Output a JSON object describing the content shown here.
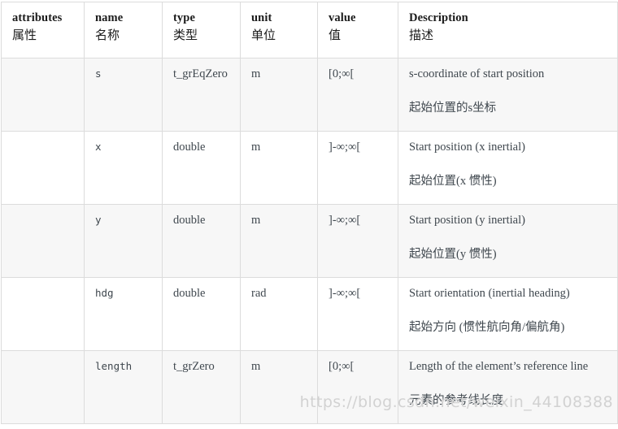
{
  "table": {
    "columns": [
      {
        "key": "attributes",
        "label_en": "attributes",
        "label_zh": "属性"
      },
      {
        "key": "name",
        "label_en": "name",
        "label_zh": "名称"
      },
      {
        "key": "type",
        "label_en": "type",
        "label_zh": "类型"
      },
      {
        "key": "unit",
        "label_en": "unit",
        "label_zh": "单位"
      },
      {
        "key": "value",
        "label_en": "value",
        "label_zh": "值"
      },
      {
        "key": "description",
        "label_en": "Description",
        "label_zh": "描述"
      }
    ],
    "rows": [
      {
        "attributes": "",
        "name": "s",
        "type": "t_grEqZero",
        "unit": "m",
        "value": "[0;∞[",
        "description_en": "s-coordinate of start position",
        "description_zh": "起始位置的s坐标"
      },
      {
        "attributes": "",
        "name": "x",
        "type": "double",
        "unit": "m",
        "value": "]-∞;∞[",
        "description_en": "Start position (x inertial)",
        "description_zh": "起始位置(x 惯性)"
      },
      {
        "attributes": "",
        "name": "y",
        "type": "double",
        "unit": "m",
        "value": "]-∞;∞[",
        "description_en": "Start position (y inertial)",
        "description_zh": "起始位置(y 惯性)"
      },
      {
        "attributes": "",
        "name": "hdg",
        "type": "double",
        "unit": "rad",
        "value": "]-∞;∞[",
        "description_en": "Start orientation (inertial heading)",
        "description_zh": "起始方向 (惯性航向角/偏航角)"
      },
      {
        "attributes": "",
        "name": "length",
        "type": "t_grZero",
        "unit": "m",
        "value": "[0;∞[",
        "description_en": "Length of the element’s reference line",
        "description_zh": "元素的参考线长度"
      }
    ]
  },
  "watermark": {
    "text": "https://blog.csdn.net/weixin_44108388"
  },
  "colors": {
    "border": "#dcdcdc",
    "stripe": "#f7f7f7",
    "body_text": "#3f474e",
    "header_text": "#1b1b1b",
    "watermark_text": "#d2d2d2"
  }
}
